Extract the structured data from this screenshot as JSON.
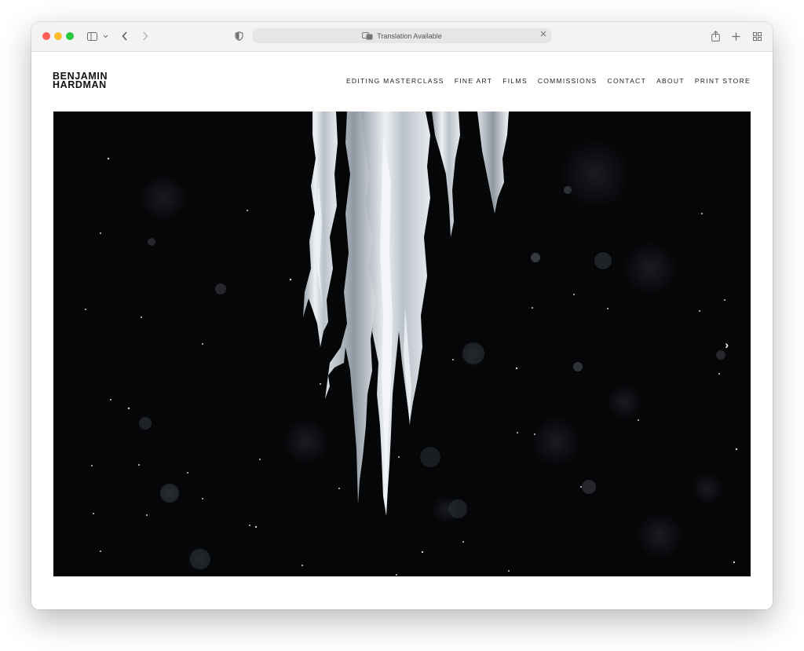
{
  "browser": {
    "address_text": "Translation Available"
  },
  "site": {
    "logo_line1": "BENJAMIN",
    "logo_line2": "HARDMAN",
    "nav": [
      {
        "label": "EDITING MASTERCLASS"
      },
      {
        "label": "FINE ART"
      },
      {
        "label": "FILMS"
      },
      {
        "label": "COMMISSIONS"
      },
      {
        "label": "CONTACT"
      },
      {
        "label": "ABOUT"
      },
      {
        "label": "PRINT STORE"
      }
    ]
  },
  "hero": {
    "image_subject": "icicles on black background",
    "next_icon": "chevron-right-icon"
  }
}
